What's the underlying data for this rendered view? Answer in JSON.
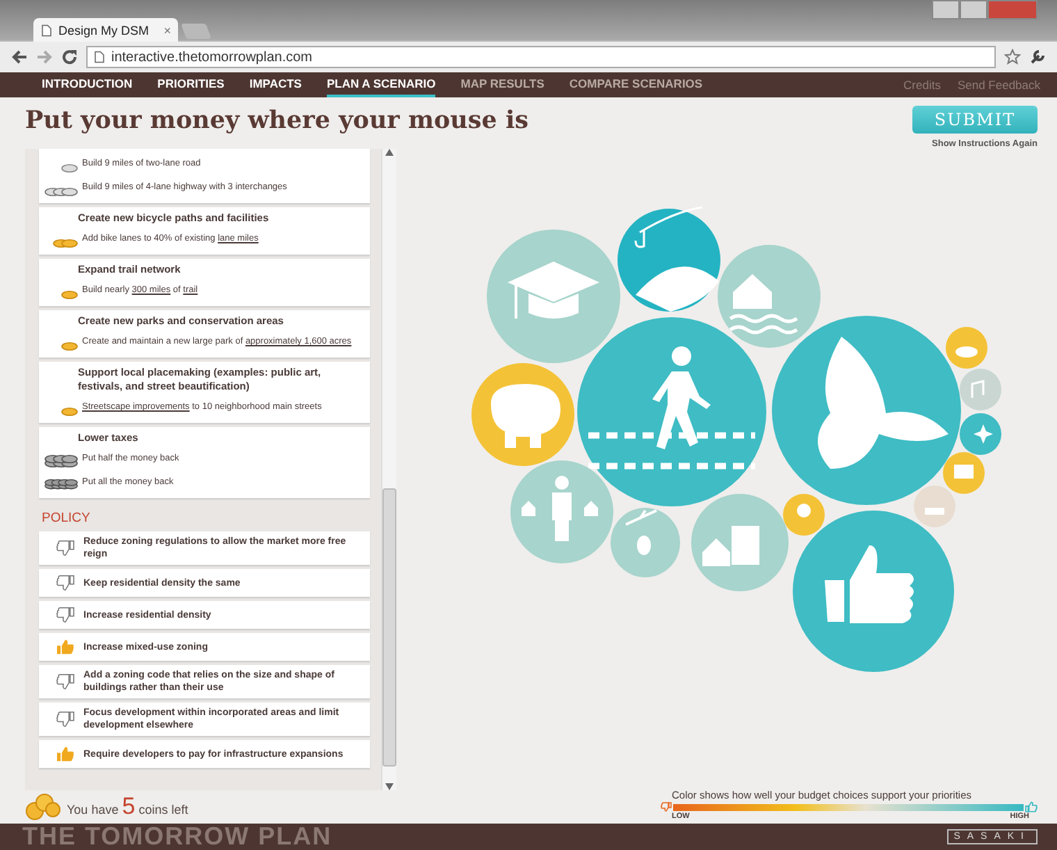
{
  "browser": {
    "tab_title": "Design My DSM",
    "tab_close": "×",
    "url": "interactive.thetomorrowplan.com"
  },
  "nav": {
    "tabs": [
      {
        "label": "INTRODUCTION",
        "selected": false,
        "disabled": false
      },
      {
        "label": "PRIORITIES",
        "selected": false,
        "disabled": false
      },
      {
        "label": "IMPACTS",
        "selected": false,
        "disabled": false
      },
      {
        "label": "PLAN A SCENARIO",
        "selected": true,
        "disabled": false
      },
      {
        "label": "MAP RESULTS",
        "selected": false,
        "disabled": true
      },
      {
        "label": "COMPARE SCENARIOS",
        "selected": false,
        "disabled": true
      }
    ],
    "links": [
      "Credits",
      "Send Feedback"
    ]
  },
  "heading": "Put your money where your mouse is",
  "submit": "SUBMIT",
  "instructions_link": "Show Instructions Again",
  "budget": [
    {
      "options": [
        {
          "kind": "silver-one",
          "segments": [
            {
              "text": "Build 9 miles of two-lane road",
              "link": false
            }
          ]
        },
        {
          "kind": "silver-stack",
          "segments": [
            {
              "text": "Build 9 miles of 4-lane highway with 3 interchanges",
              "link": false
            }
          ]
        }
      ]
    },
    {
      "title": "Create new bicycle paths and facilities",
      "options": [
        {
          "kind": "gold-pair",
          "segments": [
            {
              "text": "Add bike lanes to 40% of existing ",
              "link": false
            },
            {
              "text": "lane miles",
              "link": true
            }
          ]
        }
      ]
    },
    {
      "title": "Expand trail network",
      "options": [
        {
          "kind": "gold-one",
          "segments": [
            {
              "text": "Build nearly ",
              "link": false
            },
            {
              "text": "300 miles",
              "link": true
            },
            {
              "text": " of ",
              "link": false
            },
            {
              "text": "trail",
              "link": true
            }
          ]
        }
      ]
    },
    {
      "title": "Create new parks and conservation areas",
      "options": [
        {
          "kind": "gold-one",
          "segments": [
            {
              "text": "Create and maintain a new large park of ",
              "link": false
            },
            {
              "text": "approximately 1,600 acres",
              "link": true
            }
          ]
        }
      ]
    },
    {
      "title": "Support local placemaking (examples: public art, festivals, and street beautification)",
      "options": [
        {
          "kind": "gold-one",
          "segments": [
            {
              "text": "Streetscape improvements",
              "link": true
            },
            {
              "text": " to 10 neighborhood main streets",
              "link": false
            }
          ]
        }
      ]
    },
    {
      "title": "Lower taxes",
      "options": [
        {
          "kind": "dark-stack",
          "segments": [
            {
              "text": "Put half the money back",
              "link": false
            }
          ]
        },
        {
          "kind": "dark-pile",
          "segments": [
            {
              "text": "Put all the money back",
              "link": false
            }
          ]
        }
      ]
    }
  ],
  "policy": {
    "heading": "POLICY",
    "items": [
      {
        "text": "Reduce zoning regulations to allow the market more free reign",
        "selected": false
      },
      {
        "text": "Keep residential density the same",
        "selected": false
      },
      {
        "text": "Increase residential density",
        "selected": false
      },
      {
        "text": "Increase mixed-use zoning",
        "selected": true
      },
      {
        "text": "Add a zoning code that relies on the size and shape of buildings rather than their use",
        "selected": false
      },
      {
        "text": "Focus development within incorporated areas and limit development elsewhere",
        "selected": false
      },
      {
        "text": "Require developers to pay for infrastructure expansions",
        "selected": true
      }
    ]
  },
  "coins": {
    "prefix": "You have",
    "count": "5",
    "suffix": "coins left"
  },
  "legend": {
    "caption": "Color shows how well your budget choices support your priorities",
    "low": "LOW",
    "high": "HIGH"
  },
  "footer": {
    "brand": "THE TOMORROW PLAN",
    "partner": "SASAKI"
  }
}
